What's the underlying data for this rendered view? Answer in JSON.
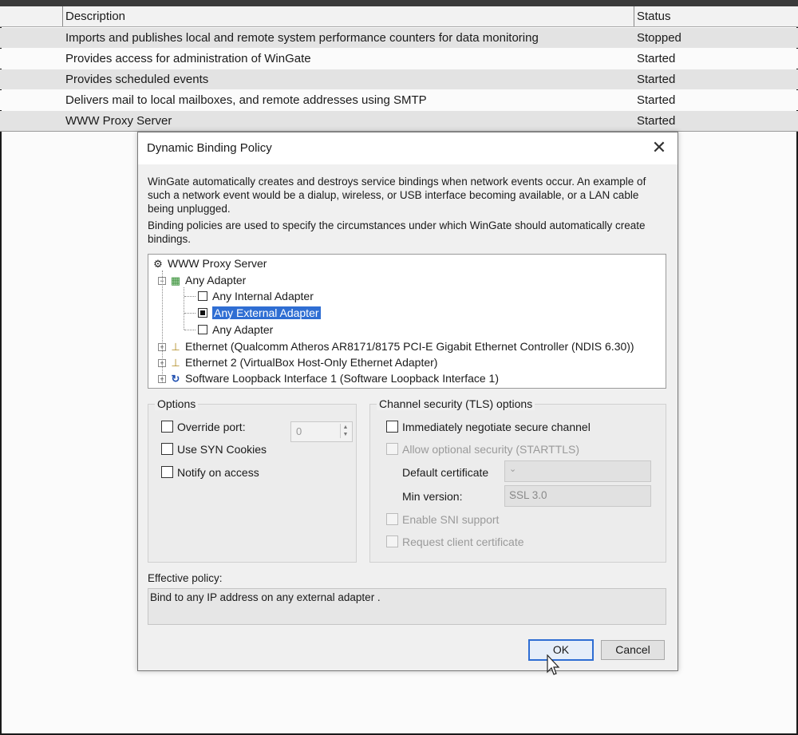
{
  "services": {
    "headers": {
      "description": "Description",
      "status": "Status"
    },
    "rows": [
      {
        "description": "Imports and publishes local and remote system performance counters for data monitoring",
        "status": "Stopped"
      },
      {
        "description": "Provides access for administration of WinGate",
        "status": "Started"
      },
      {
        "description": "Provides scheduled events",
        "status": "Started"
      },
      {
        "description": "Delivers mail to local mailboxes, and remote addresses using SMTP",
        "status": "Started"
      },
      {
        "description": "WWW Proxy Server",
        "status": "Started"
      }
    ]
  },
  "dialog": {
    "title": "Dynamic Binding Policy",
    "intro_1": "WinGate automatically creates and destroys service bindings when network events occur. An example of such a network event would be a dialup, wireless, or USB interface becoming available, or a LAN cable being unplugged.",
    "intro_2": "Binding policies are used to specify the circumstances under which WinGate should automatically create bindings.",
    "tree": {
      "root": "WWW Proxy Server",
      "any_adapter": "Any Adapter",
      "children": [
        {
          "label": "Any Internal Adapter",
          "checked": false,
          "selected": false
        },
        {
          "label": "Any External Adapter",
          "checked": true,
          "selected": true
        },
        {
          "label": "Any Adapter",
          "checked": false,
          "selected": false
        }
      ],
      "adapters": [
        {
          "label": "Ethernet (Qualcomm Atheros AR8171/8175 PCI-E Gigabit Ethernet Controller (NDIS 6.30))",
          "icon": "network-adapter-icon"
        },
        {
          "label": "Ethernet 2 (VirtualBox Host-Only Ethernet Adapter)",
          "icon": "network-adapter-icon"
        },
        {
          "label": "Software Loopback Interface 1 (Software Loopback Interface 1)",
          "icon": "loopback-icon"
        }
      ]
    },
    "options": {
      "label": "Options",
      "override_port": "Override port:",
      "port_value": "0",
      "syn_cookies": "Use SYN Cookies",
      "notify": "Notify on access"
    },
    "tls": {
      "label": "Channel security (TLS) options",
      "negotiate": "Immediately negotiate secure channel",
      "starttls": "Allow optional security (STARTTLS)",
      "default_cert_label": "Default certificate",
      "default_cert_value": "",
      "min_version_label": "Min version:",
      "min_version_value": "SSL 3.0",
      "sni": "Enable SNI support",
      "client_cert": "Request client certificate"
    },
    "effective": {
      "label": "Effective policy:",
      "value": "Bind to any IP address on any external adapter ."
    },
    "buttons": {
      "ok": "OK",
      "cancel": "Cancel"
    }
  }
}
